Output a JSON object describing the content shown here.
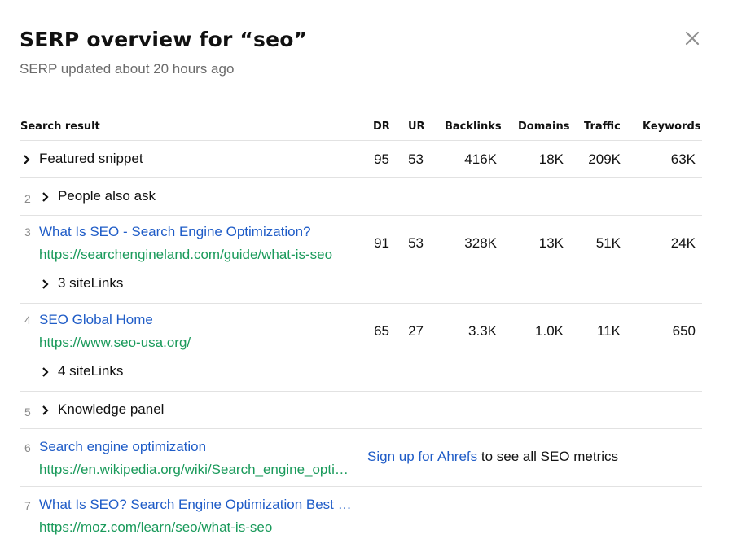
{
  "header": {
    "title": "SERP overview for “seo”",
    "subtitle": "SERP updated about 20 hours ago"
  },
  "columns": [
    "Search result",
    "DR",
    "UR",
    "Backlinks",
    "Domains",
    "Traffic",
    "Keywords"
  ],
  "rows": [
    {
      "index": "",
      "label": "Featured snippet",
      "dr": "95",
      "ur": "53",
      "backlinks": "416K",
      "domains": "18K",
      "traffic": "209K",
      "keywords": "63K"
    },
    {
      "index": "2",
      "label": "People also ask"
    },
    {
      "index": "3",
      "title": "What Is SEO - Search Engine Optimization?",
      "url": "https://searchengineland.com/guide/what-is-seo",
      "sitelinks": "3 siteLinks",
      "dr": "91",
      "ur": "53",
      "backlinks": "328K",
      "domains": "13K",
      "traffic": "51K",
      "keywords": "24K"
    },
    {
      "index": "4",
      "title": "SEO Global Home",
      "url": "https://www.seo-usa.org/",
      "sitelinks": "4 siteLinks",
      "dr": "65",
      "ur": "27",
      "backlinks": "3.3K",
      "domains": "1.0K",
      "traffic": "11K",
      "keywords": "650"
    },
    {
      "index": "5",
      "label": "Knowledge panel"
    },
    {
      "index": "6",
      "title": "Search engine optimization",
      "url": "https://en.wikipedia.org/wiki/Search_engine_optimization",
      "signup_link": "Sign up for Ahrefs",
      "signup_text": " to see all SEO metrics"
    },
    {
      "index": "7",
      "title": "What Is SEO? Search Engine Optimization Best Practices",
      "url": "https://moz.com/learn/seo/what-is-seo"
    }
  ],
  "icons": {
    "close": "close-icon",
    "expand": "chevron-right-icon"
  },
  "colors": {
    "link": "#1f5cc7",
    "url": "#1a9a5b",
    "muted": "#6b6b6b",
    "divider": "#e2e2e2"
  }
}
